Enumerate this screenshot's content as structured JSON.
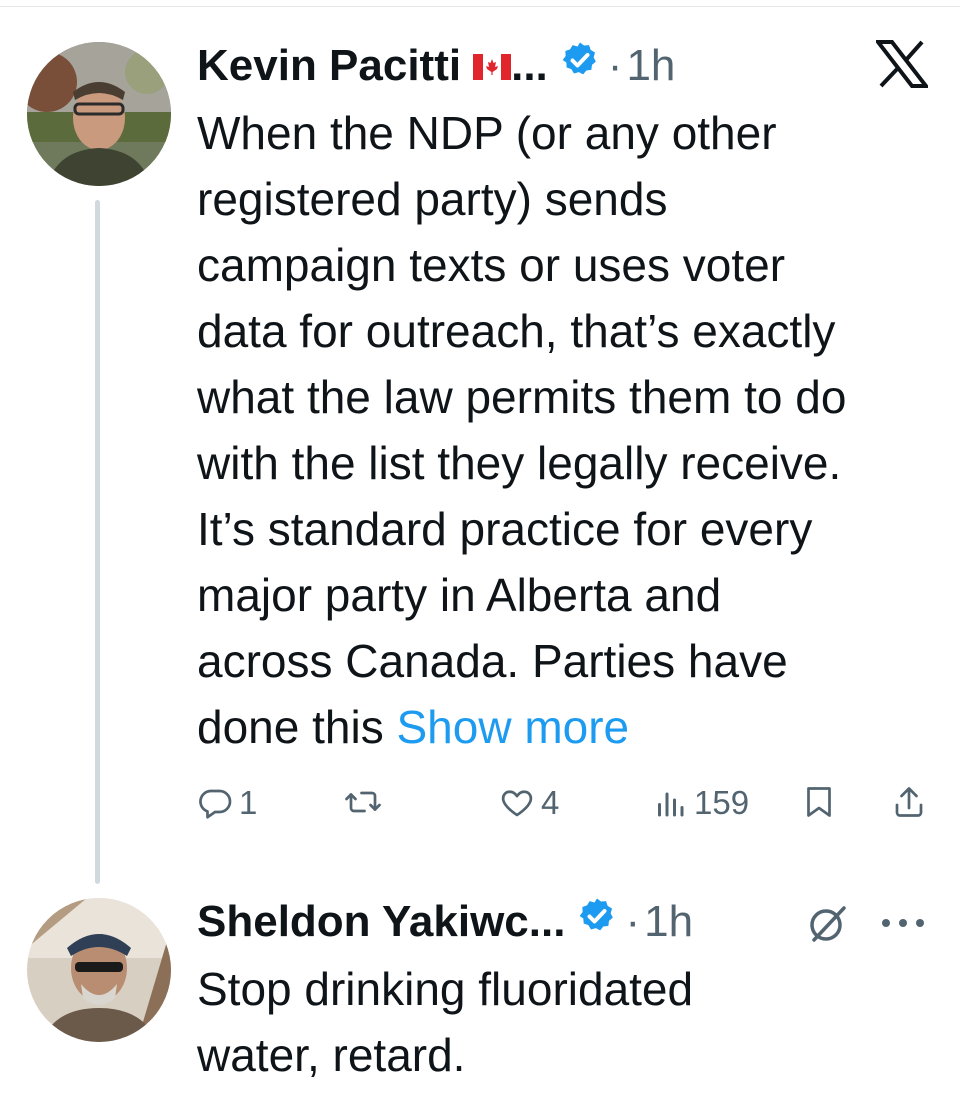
{
  "tweets": [
    {
      "author": "Kevin Pacitti",
      "handle_trunc": "...",
      "flag": "canada-flag",
      "verified": true,
      "dot": "·",
      "time": "1h",
      "text_lines": [
        "When the NDP (or any other",
        "registered party) sends",
        "campaign texts or uses voter",
        "data for outreach, that’s exactly",
        "what the law permits them to do",
        "with the list they legally receive.",
        "It’s standard practice for every",
        "major party in Alberta and",
        "across Canada. Parties have"
      ],
      "text_last_prefix": "done this ",
      "show_more": "Show more",
      "actions": {
        "replies": "1",
        "reposts": "",
        "likes": "4",
        "views": "159"
      },
      "top_right_icon": "x-logo-icon"
    },
    {
      "author": "Sheldon Yakiwc...",
      "verified": true,
      "dot": "·",
      "time": "1h",
      "text_lines": [
        "Stop drinking fluoridated",
        "water, retard."
      ],
      "top_right_icons": [
        "grok-icon",
        "more-options-icon"
      ]
    }
  ],
  "colors": {
    "accent": "#1d9bf0",
    "text": "#0f1419",
    "muted": "#536471",
    "thread_line": "#cfd9de"
  }
}
